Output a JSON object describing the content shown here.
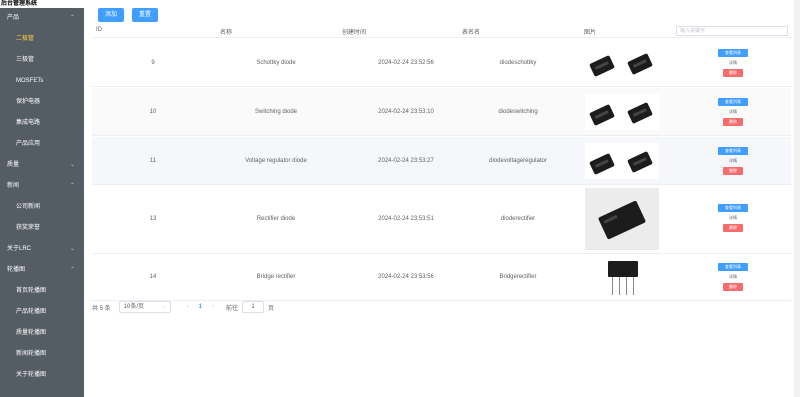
{
  "app": {
    "title": "后台管理系统"
  },
  "sidebar": {
    "items": [
      {
        "label": "产品",
        "type": "group",
        "chevron": "^"
      },
      {
        "label": "二极管",
        "type": "sub",
        "active": true
      },
      {
        "label": "三极管",
        "type": "sub"
      },
      {
        "label": "MOSFETs",
        "type": "sub"
      },
      {
        "label": "保护电器",
        "type": "sub"
      },
      {
        "label": "集成电路",
        "type": "sub"
      },
      {
        "label": "产品应用",
        "type": "sub"
      },
      {
        "label": "质量",
        "type": "group",
        "chevron": "v"
      },
      {
        "label": "新闻",
        "type": "group",
        "chevron": "^"
      },
      {
        "label": "公司新闻",
        "type": "sub"
      },
      {
        "label": "获奖荣誉",
        "type": "sub"
      },
      {
        "label": "关于LRC",
        "type": "group",
        "chevron": "v"
      },
      {
        "label": "轮播图",
        "type": "group",
        "chevron": "^"
      },
      {
        "label": "首页轮播图",
        "type": "sub"
      },
      {
        "label": "产品轮播图",
        "type": "sub"
      },
      {
        "label": "质量轮播图",
        "type": "sub"
      },
      {
        "label": "新闻轮播图",
        "type": "sub"
      },
      {
        "label": "关于轮播图",
        "type": "sub"
      }
    ]
  },
  "toolbar": {
    "add_label": "添加",
    "reset_label": "重置"
  },
  "table": {
    "headers": {
      "id": "ID",
      "name": "名称",
      "created": "创建时间",
      "alias": "表名名",
      "image": "图片"
    },
    "search_placeholder": "输入关键字",
    "rows": [
      {
        "id": "9",
        "name": "Schottky diode",
        "created": "2024-02-24 23:52:56",
        "alias": "diodeschottky"
      },
      {
        "id": "10",
        "name": "Switching diode",
        "created": "2024-02-24 23:53:10",
        "alias": "diodeswitching"
      },
      {
        "id": "11",
        "name": "Voltage regulator diode",
        "created": "2024-02-24 23:53:27",
        "alias": "diodevoltageregulator"
      },
      {
        "id": "13",
        "name": "Rectifier diode",
        "created": "2024-02-24 23:53:51",
        "alias": "dioderectifier"
      },
      {
        "id": "14",
        "name": "Bridge rectifier",
        "created": "2024-02-24 23:53:56",
        "alias": "Bridgerectifier"
      }
    ],
    "actions": {
      "view": "查看列表",
      "detail": "详情",
      "delete": "删除"
    }
  },
  "pagination": {
    "total": "共 5 条",
    "page_size": "10条/页",
    "current_page": "1",
    "goto_label": "前往",
    "goto_value": "1",
    "page_suffix": "页"
  },
  "colors": {
    "sidebar_bg": "#545c64",
    "active": "#ffd04b",
    "primary": "#409eff",
    "danger": "#f56c6c"
  }
}
